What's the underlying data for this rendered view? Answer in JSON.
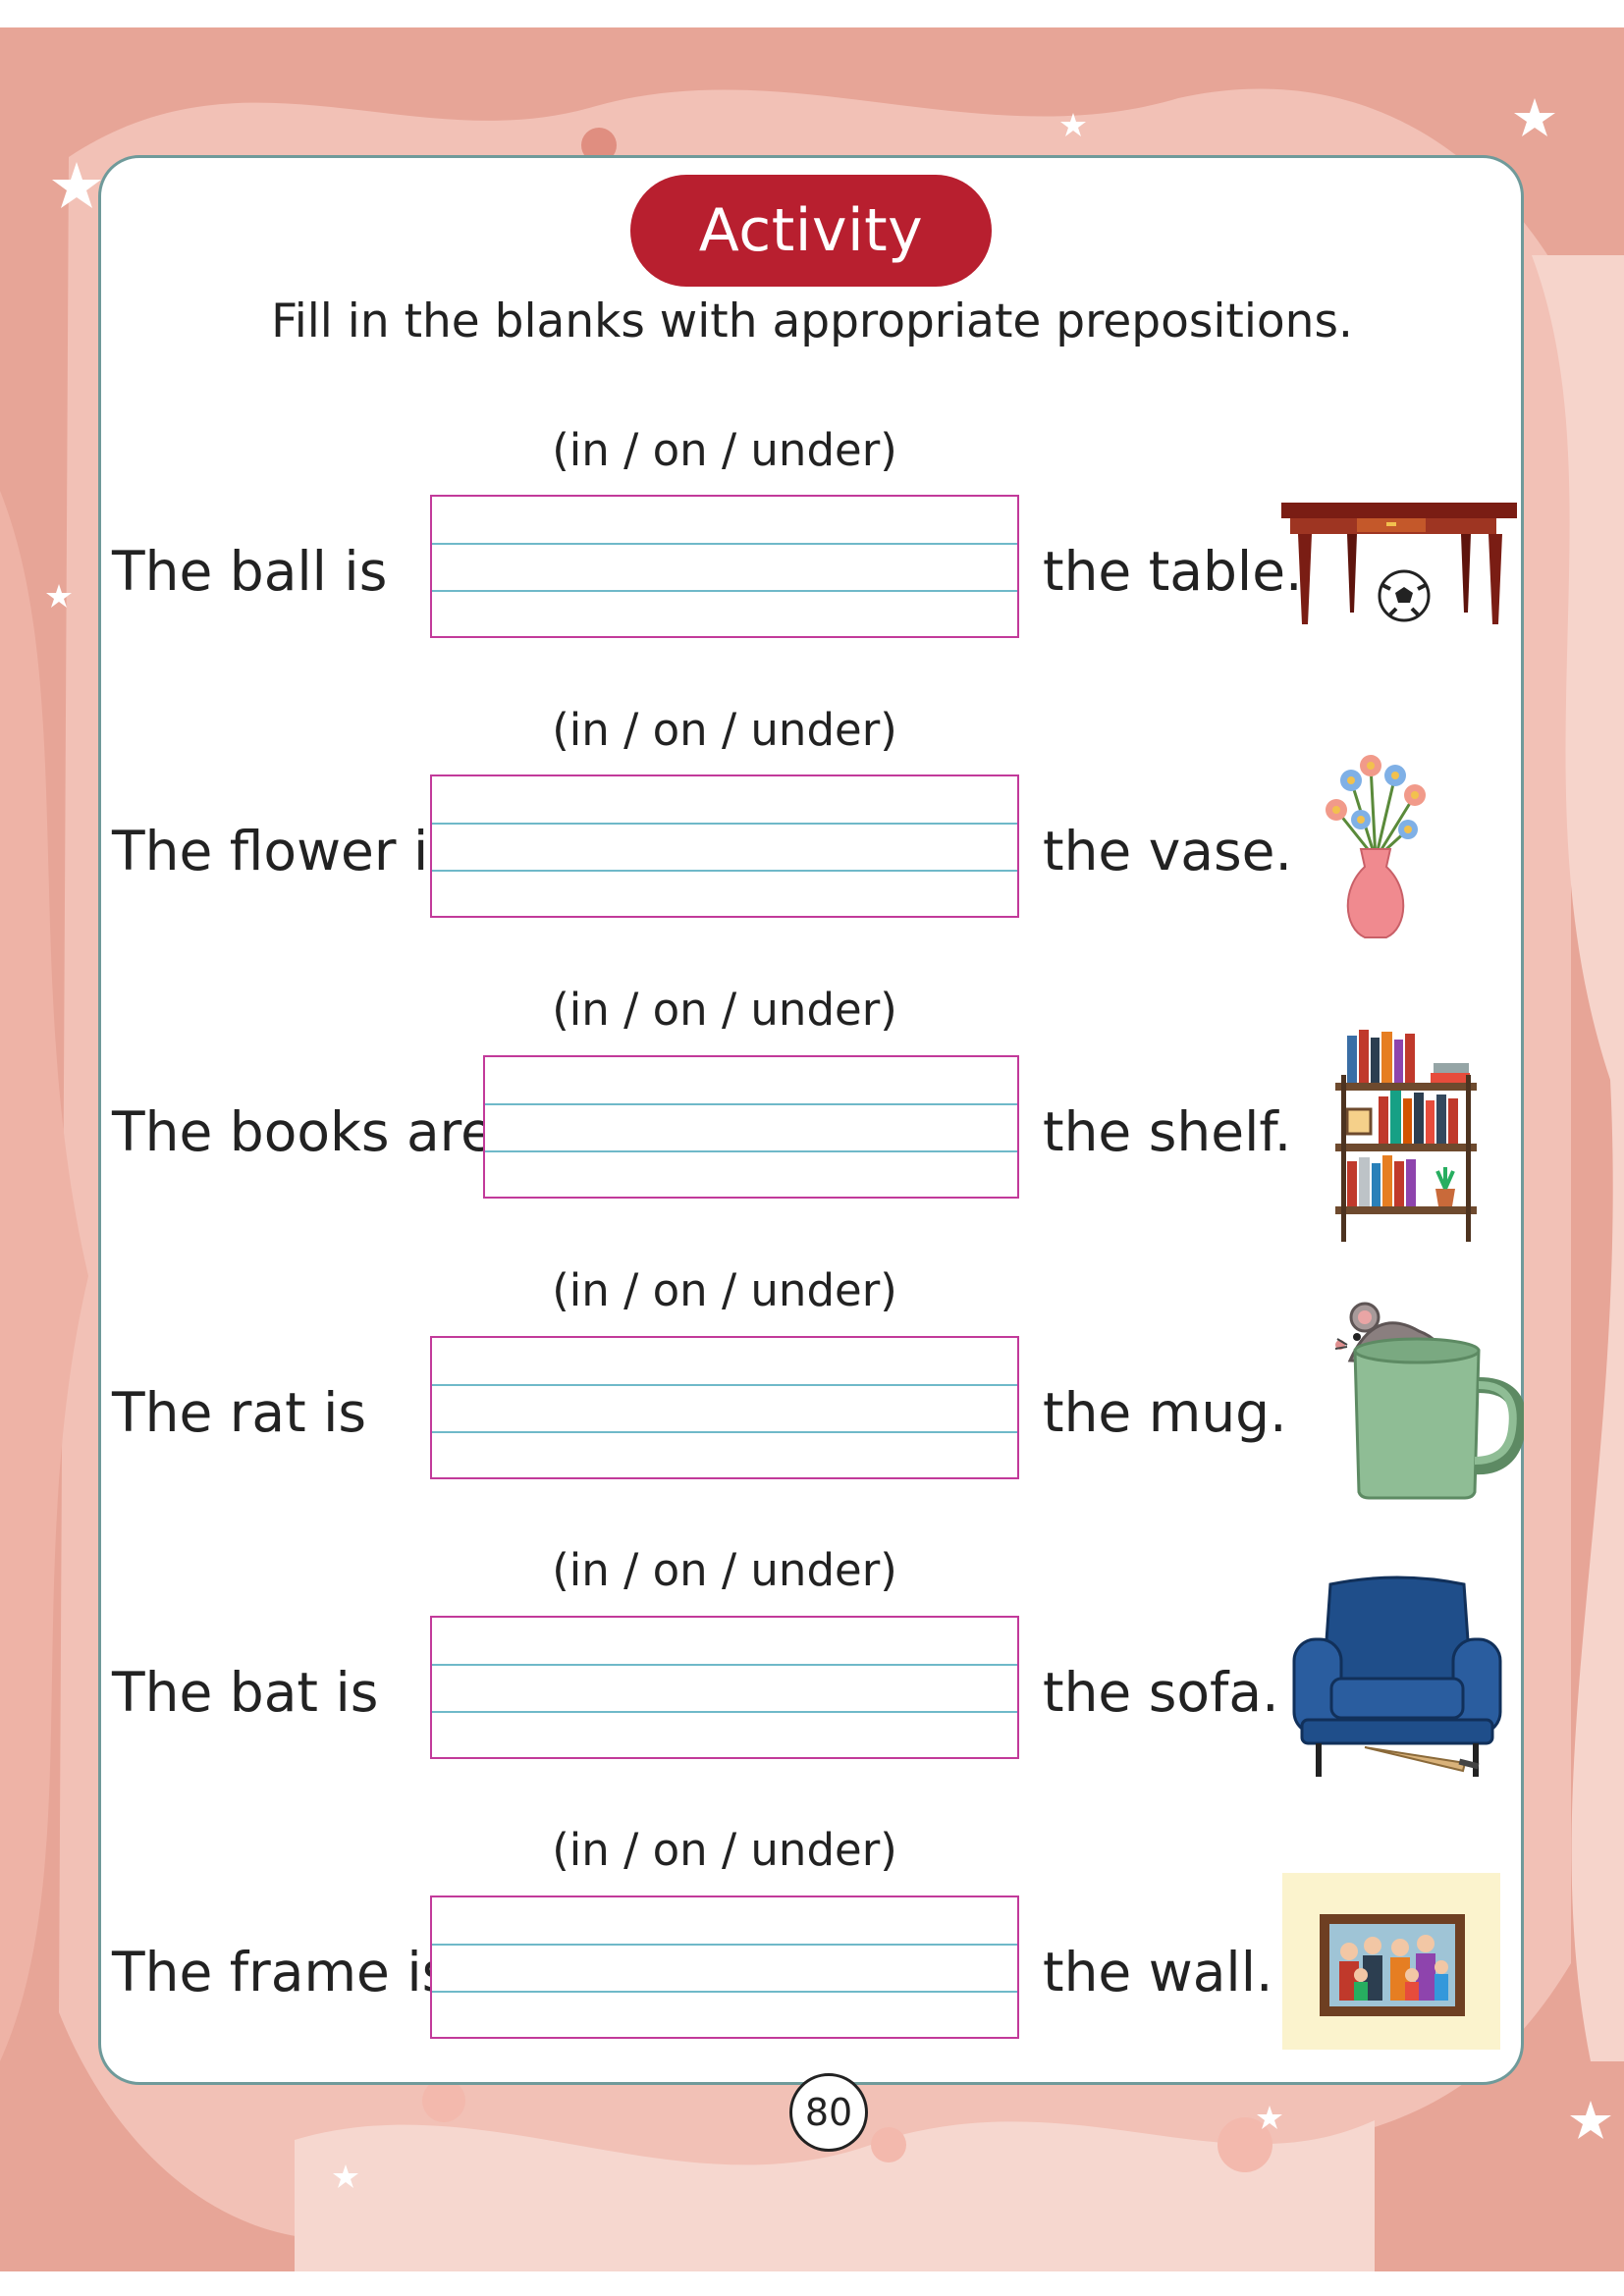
{
  "activity": {
    "title": "Activity",
    "instruction": "Fill in the blanks with appropriate prepositions."
  },
  "items": [
    {
      "options": "(in / on / under)",
      "lead": "The ball is",
      "tail": "the table.",
      "icon": "table-ball-icon"
    },
    {
      "options": "(in / on / under)",
      "lead": "The flower is",
      "tail": "the vase.",
      "icon": "flower-vase-icon"
    },
    {
      "options": "(in / on / under)",
      "lead": "The books are",
      "tail": "the shelf.",
      "icon": "bookshelf-icon"
    },
    {
      "options": "(in / on / under)",
      "lead": "The rat is",
      "tail": "the mug.",
      "icon": "rat-mug-icon"
    },
    {
      "options": "(in / on / under)",
      "lead": "The bat is",
      "tail": "the sofa.",
      "icon": "sofa-bat-icon"
    },
    {
      "options": "(in / on / under)",
      "lead": "The frame is",
      "tail": "the wall.",
      "icon": "picture-frame-icon"
    }
  ],
  "page_number": "80",
  "colors": {
    "pill": "#b81f2f",
    "background": "#e8a899",
    "blank_border": "#c23a9a",
    "blank_guides": "#6fb9c9"
  }
}
